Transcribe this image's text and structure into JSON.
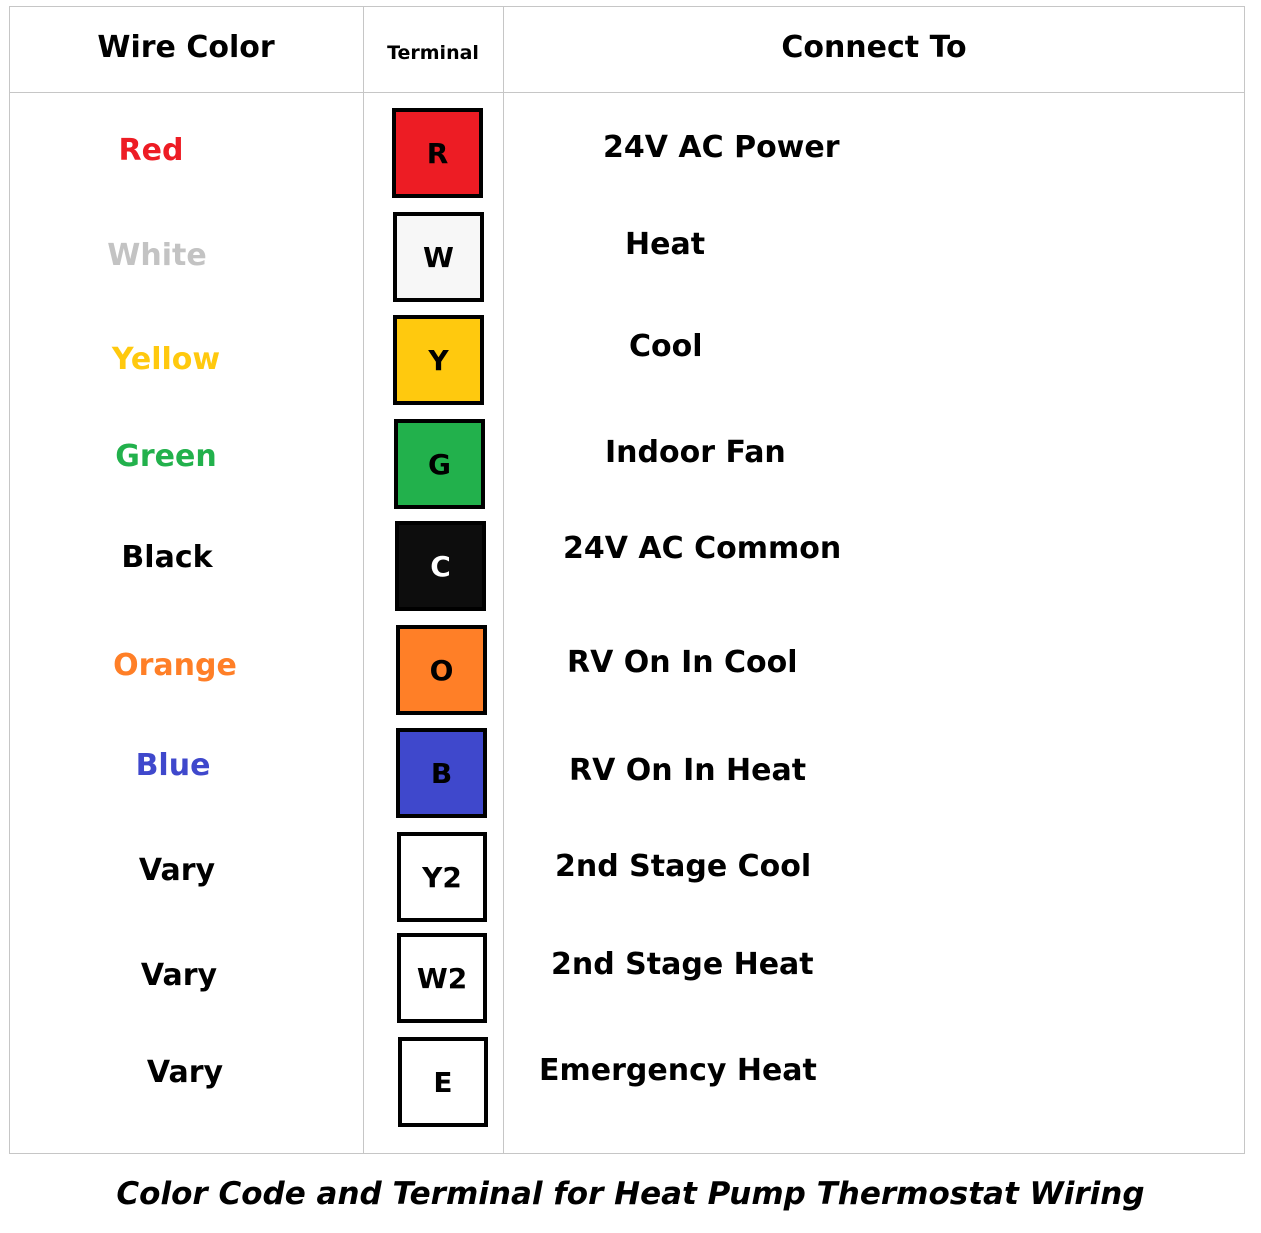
{
  "header": {
    "wire_color": "Wire Color",
    "terminal": "Terminal",
    "connect_to": "Connect To"
  },
  "rows": [
    {
      "wire": "Red",
      "wire_color": "#ed1c24",
      "terminal": "R",
      "terminal_fill": "#ed1c24",
      "terminal_text_color": "#000000",
      "connect": "24V AC Power"
    },
    {
      "wire": "White",
      "wire_color": "#c3c3c3",
      "terminal": "W",
      "terminal_fill": "#f7f7f7",
      "terminal_text_color": "#000000",
      "connect": "Heat"
    },
    {
      "wire": "Yellow",
      "wire_color": "#ffc90e",
      "terminal": "Y",
      "terminal_fill": "#ffc90e",
      "terminal_text_color": "#000000",
      "connect": "Cool"
    },
    {
      "wire": "Green",
      "wire_color": "#22b14c",
      "terminal": "G",
      "terminal_fill": "#22b14c",
      "terminal_text_color": "#000000",
      "connect": "Indoor Fan"
    },
    {
      "wire": "Black",
      "wire_color": "#000000",
      "terminal": "C",
      "terminal_fill": "#0d0d0d",
      "terminal_text_color": "#ffffff",
      "connect": "24V AC Common"
    },
    {
      "wire": "Orange",
      "wire_color": "#ff7f27",
      "terminal": "O",
      "terminal_fill": "#ff7f27",
      "terminal_text_color": "#000000",
      "connect": "RV On In Cool"
    },
    {
      "wire": "Blue",
      "wire_color": "#3f48cc",
      "terminal": "B",
      "terminal_fill": "#3f48cc",
      "terminal_text_color": "#000000",
      "connect": "RV On In Heat"
    },
    {
      "wire": "Vary",
      "wire_color": "#000000",
      "terminal": "Y2",
      "terminal_fill": "#ffffff",
      "terminal_text_color": "#000000",
      "connect": "2nd Stage Cool"
    },
    {
      "wire": "Vary",
      "wire_color": "#000000",
      "terminal": "W2",
      "terminal_fill": "#ffffff",
      "terminal_text_color": "#000000",
      "connect": "2nd Stage Heat"
    },
    {
      "wire": "Vary",
      "wire_color": "#000000",
      "terminal": "E",
      "terminal_fill": "#ffffff",
      "terminal_text_color": "#000000",
      "connect": "Emergency Heat"
    }
  ],
  "caption": "Color Code and Terminal for Heat Pump Thermostat Wiring"
}
